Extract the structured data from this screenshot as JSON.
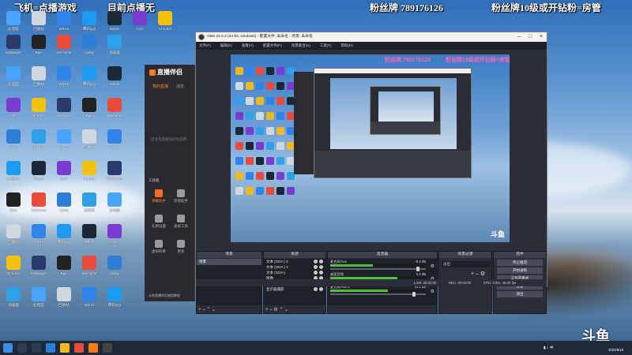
{
  "overlay": {
    "left_text": "飞机=点播游戏",
    "mid_text": "目前点播无",
    "fans_text": "粉丝牌 789176126",
    "right_text": "粉丝牌10级或开钻粉=房管"
  },
  "desktop_icons": [
    {
      "label": "此电脑",
      "color": "#4aa3ff"
    },
    {
      "label": "回收站",
      "color": "#cfd8e0"
    },
    {
      "label": "Win10",
      "color": "#2e84e8"
    },
    {
      "label": "腾讯QQ",
      "color": "#1e9bf0"
    },
    {
      "label": "Steam",
      "color": "#1b2838"
    },
    {
      "label": "GoG",
      "color": "#7a3bd0"
    },
    {
      "label": "Chrome",
      "color": "#f4c20d"
    },
    {
      "label": "Wallpaper",
      "color": "#2a3a6a"
    },
    {
      "label": "Epic",
      "color": "#222222"
    },
    {
      "label": "WeGame",
      "color": "#e74c3c"
    },
    {
      "label": "Uplay",
      "color": "#2d7fd6"
    },
    {
      "label": "加速器",
      "color": "#2f9fe8"
    }
  ],
  "companion": {
    "brand": "直播伴侣",
    "tab_left": "我的直播",
    "tab_right": "消息",
    "empty_text": "还没有直播间的动态哦~",
    "section_tools": "工具箱",
    "tools": [
      {
        "label": "弹幕助手",
        "hot": true
      },
      {
        "label": "房管助手",
        "hot": false
      },
      {
        "label": "礼物设置",
        "hot": false
      },
      {
        "label": "录屏工具",
        "hot": false
      },
      {
        "label": "虚拟形象",
        "hot": false
      },
      {
        "label": "更多",
        "hot": false
      }
    ],
    "footer": "斗鱼直播伴侣使用教程"
  },
  "obs": {
    "title": "OBS 22.0.2 (64-bit, windows) - 配置文件: 未命名 - 场景: 未命名",
    "menu": [
      "文件(F)",
      "编辑(E)",
      "查看(V)",
      "配置文件(P)",
      "场景集合(S)",
      "工具(T)",
      "帮助(H)"
    ],
    "preview_overlay_left": "粉丝牌 789176126",
    "preview_overlay_right": "粉丝牌10级或开钻粉=房管",
    "watermark": "斗鱼",
    "docks": {
      "scenes": {
        "title": "场景",
        "items": [
          "场景"
        ]
      },
      "sources": {
        "title": "来源",
        "items": [
          "文本 (GDI+) 3",
          "文本 (GDI+) 2",
          "文本 (GDI+)",
          "图像",
          "窗口捕获",
          "显示器捕获"
        ]
      },
      "mixer": {
        "title": "混音器",
        "channels": [
          {
            "label": "麦克风/Aux",
            "db": "-9.3 dB",
            "level": 0.45,
            "fader": 0.92
          },
          {
            "label": "桌面音频",
            "db": "0.0 dB",
            "level": 0.7,
            "fader": 0.95
          },
          {
            "label": "麦克风/Aux 2",
            "db": "14.2 dB",
            "level": 0.6,
            "fader": 0.88
          }
        ]
      },
      "transitions": {
        "title": "场景过渡",
        "value": "淡出"
      },
      "controls": {
        "title": "控件",
        "buttons": [
          "停止推流",
          "开始录制",
          "工作室模式",
          "设置",
          "退出"
        ]
      }
    },
    "status": {
      "live": "LIVE: 00:00:00",
      "rec": "REC: 00:00:00",
      "cpu": "CPU: 0.6%, 45.00 fps"
    }
  },
  "taskbar": {
    "clock": "2022/6/18",
    "ime": "中"
  },
  "watermark_douyu": "斗鱼"
}
